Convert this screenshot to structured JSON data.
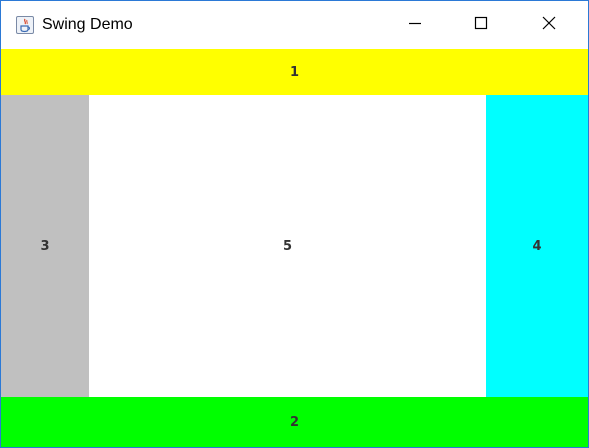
{
  "window": {
    "title": "Swing Demo",
    "icon": "java-icon",
    "controls": {
      "minimize": "minimize-icon",
      "maximize": "maximize-icon",
      "close": "close-icon"
    }
  },
  "regions": {
    "north": {
      "label": "1",
      "color": "#ffff00"
    },
    "south": {
      "label": "2",
      "color": "#00ff00"
    },
    "west": {
      "label": "3",
      "color": "#c0c0c0"
    },
    "east": {
      "label": "4",
      "color": "#00ffff"
    },
    "center": {
      "label": "5",
      "color": "#ffffff"
    }
  }
}
